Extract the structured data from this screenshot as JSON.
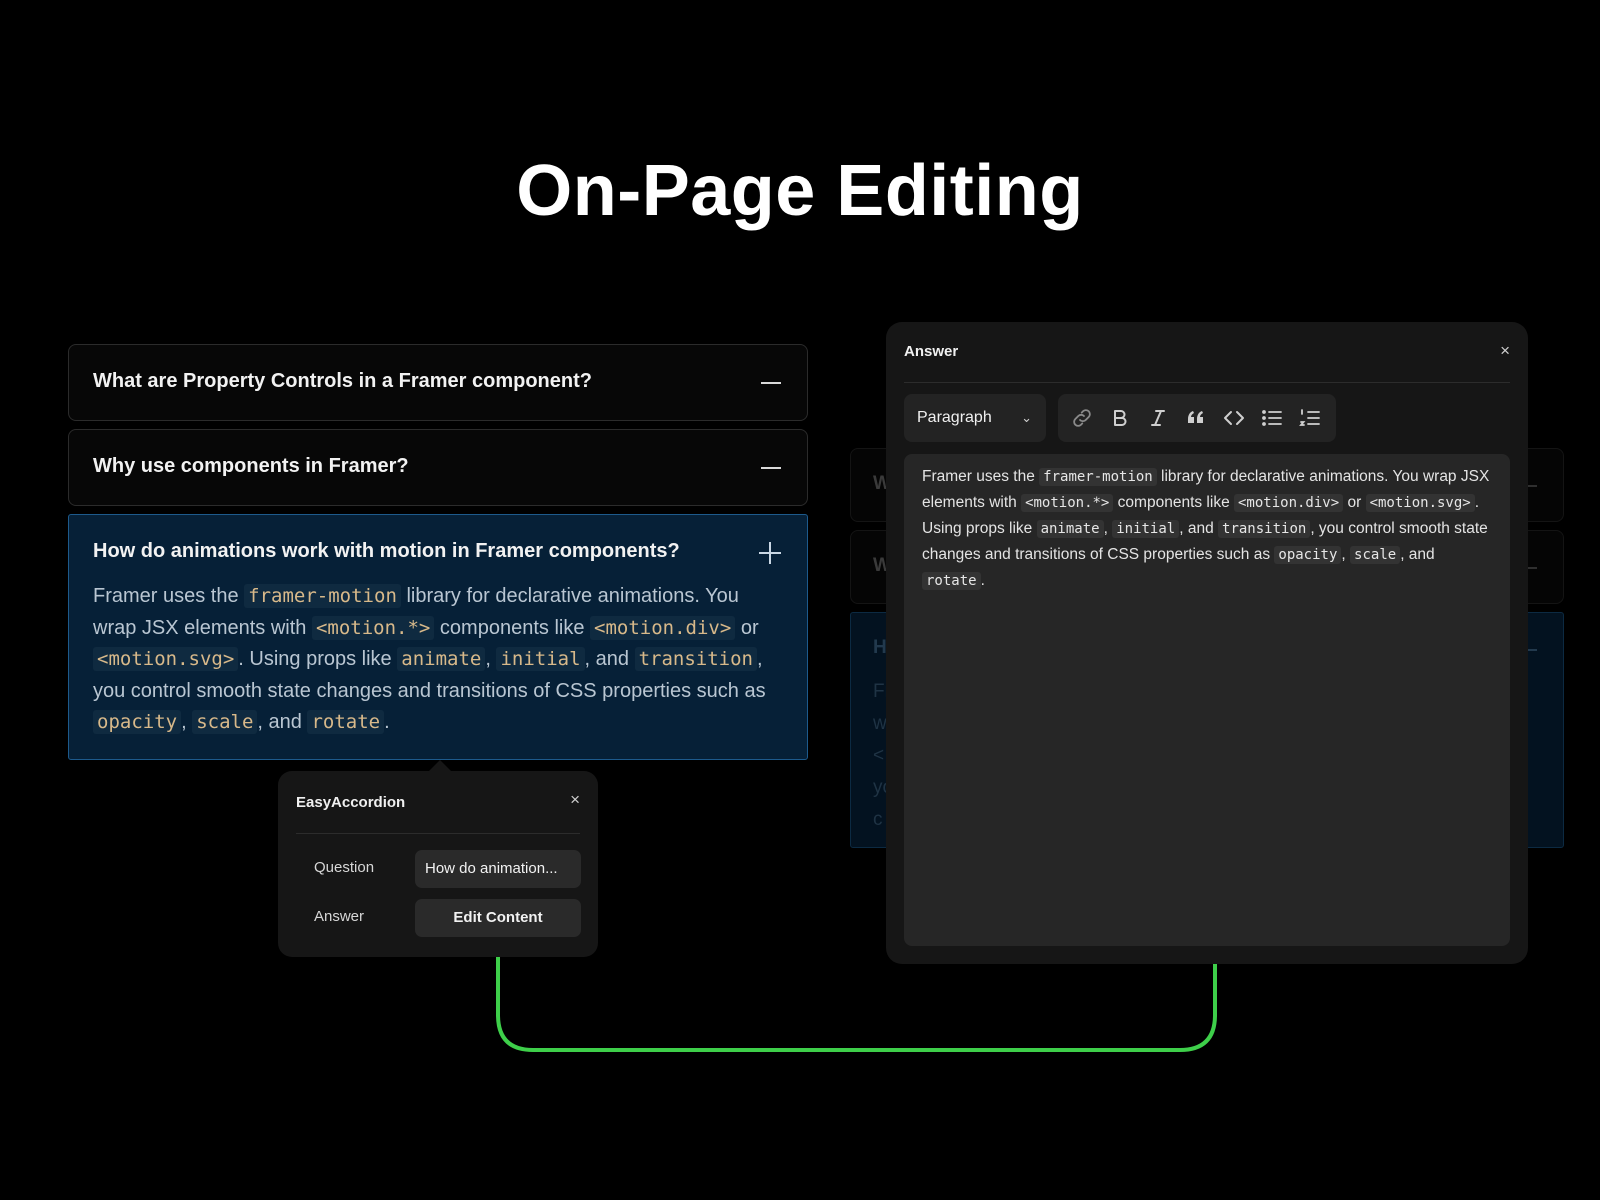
{
  "page": {
    "title": "On-Page Editing"
  },
  "accordion": {
    "items": [
      {
        "question": "What are Property Controls in a Framer component?"
      },
      {
        "question": "Why use components in Framer?"
      },
      {
        "question": "How do animations work with motion in Framer components?"
      }
    ],
    "answer": {
      "t1": "Framer uses the ",
      "c1": "framer-motion",
      "t2": " library for declarative animations. You wrap JSX elements with ",
      "c2": "<motion.*>",
      "t3": " components like ",
      "c3": "<motion.div>",
      "t4": " or ",
      "c4": "<motion.svg>",
      "t5": ". Using props like ",
      "c5": "animate",
      "t6": ", ",
      "c6": "initial",
      "t7": ", and ",
      "c7": "transition",
      "t8": ", you control smooth state changes and transitions of CSS properties such as ",
      "c8": "opacity",
      "t9": ", ",
      "c9": "scale",
      "t10": ", and ",
      "c10": "rotate",
      "t11": "."
    }
  },
  "popover": {
    "title": "EasyAccordion",
    "close": "×",
    "question_label": "Question",
    "question_value": "How do animation...",
    "answer_label": "Answer",
    "edit_button": "Edit Content"
  },
  "panel": {
    "title": "Answer",
    "close": "×",
    "format_select": "Paragraph",
    "toolbar_icons": [
      "link-icon",
      "bold-icon",
      "italic-icon",
      "quote-icon",
      "code-icon",
      "bullet-list-icon",
      "numbered-list-icon"
    ]
  },
  "ghost": {
    "letters": [
      "W",
      "W",
      "H"
    ],
    "fragments": [
      "Fr",
      "w",
      "<",
      "yo",
      "c"
    ]
  },
  "colors": {
    "background": "#000000",
    "accordion_open_bg": "#062037",
    "accordion_open_border": "#1d5a8c",
    "code_text": "#d8b98a",
    "connector": "#3ecf4a",
    "panel_bg": "#161616"
  }
}
